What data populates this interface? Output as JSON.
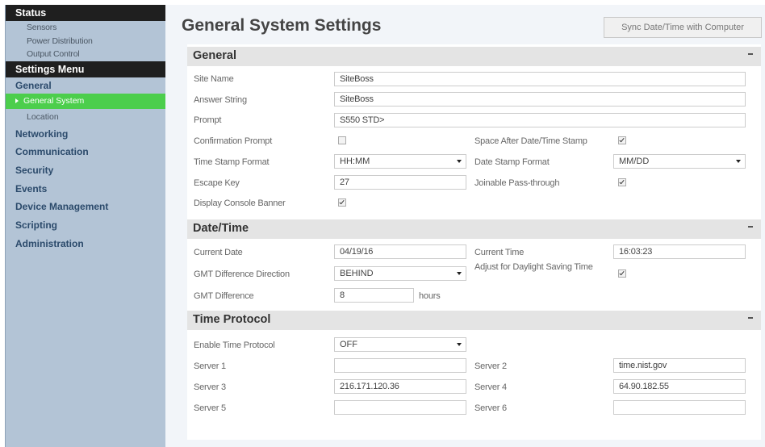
{
  "sidebar": {
    "status": "Status",
    "status_items": [
      "Sensors",
      "Power Distribution",
      "Output Control"
    ],
    "settings_menu": "Settings Menu",
    "general": "General",
    "active_item": "General System",
    "location": "Location",
    "sections": [
      "Networking",
      "Communication",
      "Security",
      "Events",
      "Device Management",
      "Scripting",
      "Administration"
    ]
  },
  "header": {
    "title": "General System Settings",
    "sync_button": "Sync Date/Time with Computer"
  },
  "general": {
    "title": "General",
    "site_name": {
      "label": "Site Name",
      "value": "SiteBoss"
    },
    "answer_string": {
      "label": "Answer String",
      "value": "SiteBoss"
    },
    "prompt": {
      "label": "Prompt",
      "value": "S550 STD>"
    },
    "confirmation_prompt": {
      "label": "Confirmation Prompt",
      "checked": false
    },
    "space_after": {
      "label": "Space After Date/Time Stamp",
      "checked": true
    },
    "time_stamp_format": {
      "label": "Time Stamp Format",
      "value": "HH:MM"
    },
    "date_stamp_format": {
      "label": "Date Stamp Format",
      "value": "MM/DD"
    },
    "escape_key": {
      "label": "Escape Key",
      "value": "27"
    },
    "joinable": {
      "label": "Joinable Pass-through",
      "checked": true
    },
    "console_banner": {
      "label": "Display Console Banner",
      "checked": true
    }
  },
  "datetime": {
    "title": "Date/Time",
    "current_date": {
      "label": "Current Date",
      "value": "04/19/16"
    },
    "current_time": {
      "label": "Current Time",
      "value": "16:03:23"
    },
    "gmt_direction": {
      "label": "GMT Difference Direction",
      "value": "BEHIND"
    },
    "dst": {
      "label": "Adjust for Daylight Saving Time",
      "checked": true
    },
    "gmt_difference": {
      "label": "GMT Difference",
      "value": "8",
      "unit": "hours"
    }
  },
  "time_protocol": {
    "title": "Time Protocol",
    "enable": {
      "label": "Enable Time Protocol",
      "value": "OFF"
    },
    "server1": {
      "label": "Server 1",
      "value": ""
    },
    "server2": {
      "label": "Server 2",
      "value": "time.nist.gov"
    },
    "server3": {
      "label": "Server 3",
      "value": "216.171.120.36"
    },
    "server4": {
      "label": "Server 4",
      "value": "64.90.182.55"
    },
    "server5": {
      "label": "Server 5",
      "value": ""
    },
    "server6": {
      "label": "Server 6",
      "value": ""
    }
  }
}
